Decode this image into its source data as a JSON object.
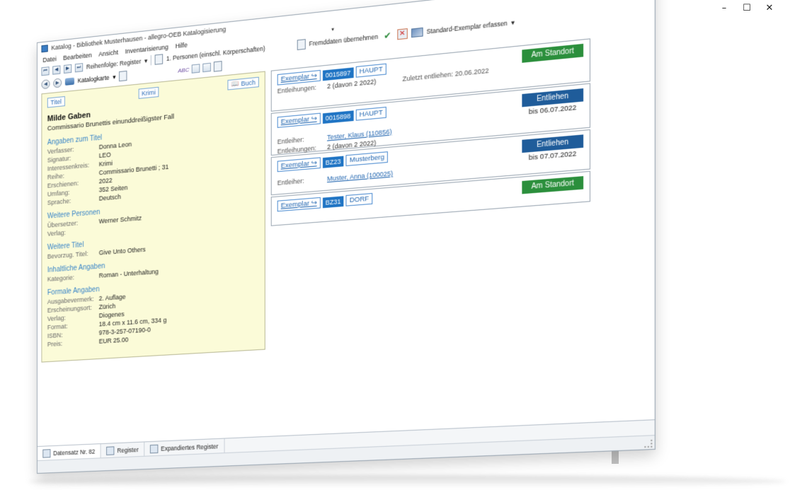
{
  "window_controls": {
    "minimize": "–",
    "maximize": "☐",
    "close": "✕"
  },
  "help": {
    "glyph": "?",
    "caret": "▾"
  },
  "titlebar": {
    "title": "Katalog - Bibliothek Musterhausen - allegro-OEB Katalogisierung"
  },
  "menu": {
    "items": [
      "Datei",
      "Bearbeiten",
      "Ansicht",
      "Inventarisierung",
      "Hilfe"
    ],
    "caret": "▾"
  },
  "toolbar": {
    "nav_first": "⏮",
    "nav_prev": "◀",
    "nav_next": "▶",
    "nav_last": "⏭",
    "order_label": "Reihenfolge: Register",
    "register_value": "1. Personen (einschl. Körperschaften)",
    "fremddaten": "Fremddaten übernehmen",
    "standard_exemplar": "Standard-Exemplar erfassen",
    "check": "✔",
    "cross": "✕",
    "caret": "▾"
  },
  "toolbar2": {
    "back": "◀",
    "forward": "▶",
    "katalogkarte": "Katalogkarte",
    "abc": "ABC",
    "caret": "▾"
  },
  "card": {
    "chip_titel": "Titel",
    "chip_krimi": "Krimi",
    "chip_buch": "Buch",
    "book_glyph": "📖",
    "title": "Milde Gaben",
    "subtitle": "Commissario Brunettis einunddreißigster Fall",
    "sections": [
      {
        "heading": "Angaben zum Titel",
        "rows": [
          {
            "label": "Verfasser:",
            "value": "Donna Leon"
          },
          {
            "label": "Signatur:",
            "value": "LEO"
          },
          {
            "label": "Interessenkreis:",
            "value": "Krimi"
          },
          {
            "label": "Reihe:",
            "value": "Commissario Brunetti ; 31"
          },
          {
            "label": "Erschienen:",
            "value": "2022"
          },
          {
            "label": "Umfang:",
            "value": "352 Seiten"
          },
          {
            "label": "Sprache:",
            "value": "Deutsch"
          }
        ]
      },
      {
        "heading": "Weitere Personen",
        "rows": [
          {
            "label": "Übersetzer:",
            "value": "Werner Schmitz"
          },
          {
            "label": "Verlag:",
            "value": ""
          }
        ]
      },
      {
        "heading": "Weitere Titel",
        "rows": [
          {
            "label": "Bevorzug. Titel:",
            "value": "Give Unto Others"
          }
        ]
      },
      {
        "heading": "Inhaltliche Angaben",
        "rows": [
          {
            "label": "Kategorie:",
            "value": "Roman - Unterhaltung"
          }
        ]
      },
      {
        "heading": "Formale Angaben",
        "rows": [
          {
            "label": "Ausgabevermerk:",
            "value": "2. Auflage"
          },
          {
            "label": "Erscheinungsort:",
            "value": "Zürich"
          },
          {
            "label": "Verlag:",
            "value": "Diogenes"
          },
          {
            "label": "Format:",
            "value": "18.4 cm x 11.6 cm, 334 g"
          },
          {
            "label": "ISBN:",
            "value": "978-3-257-07190-0"
          },
          {
            "label": "Preis:",
            "value": "EUR 25.00"
          }
        ]
      }
    ]
  },
  "exemplars": [
    {
      "link": "Exemplar ↪",
      "id": "0015897",
      "location": "HAUPT",
      "status": "Am Standort",
      "status_color": "#2b8f3c",
      "due": "",
      "entleiher_label": "",
      "entleiher": "",
      "entleihungen_label": "Entleihungen:",
      "entleihungen": "2 (davon 2 2022)",
      "zuletzt": "Zuletzt entliehen: 20.06.2022"
    },
    {
      "link": "Exemplar ↪",
      "id": "0015898",
      "location": "HAUPT",
      "status": "Entliehen",
      "status_color": "#1f5c9a",
      "due": "bis 06.07.2022",
      "entleiher_label": "Entleiher:",
      "entleiher": "Tester, Klaus (110856)",
      "entleihungen_label": "Entleihungen:",
      "entleihungen": "2 (davon 2 2022)",
      "zuletzt": ""
    },
    {
      "link": "Exemplar ↪",
      "id": "BZ23",
      "location": "Musterberg",
      "status": "Entliehen",
      "status_color": "#1f5c9a",
      "due": "bis 07.07.2022",
      "entleiher_label": "Entleiher:",
      "entleiher": "Muster, Anna (100025)",
      "entleihungen_label": "",
      "entleihungen": "",
      "zuletzt": ""
    },
    {
      "link": "Exemplar ↪",
      "id": "BZ31",
      "location": "DORF",
      "status": "Am Standort",
      "status_color": "#2b8f3c",
      "due": "",
      "entleiher_label": "",
      "entleiher": "",
      "entleihungen_label": "",
      "entleihungen": "",
      "zuletzt": ""
    }
  ],
  "tabs": [
    {
      "label": "Datensatz Nr. 82",
      "active": true
    },
    {
      "label": "Register",
      "active": false
    },
    {
      "label": "Expandiertes Register",
      "active": false
    }
  ],
  "scrollbar": {
    "up": "▲",
    "down": "▼"
  }
}
